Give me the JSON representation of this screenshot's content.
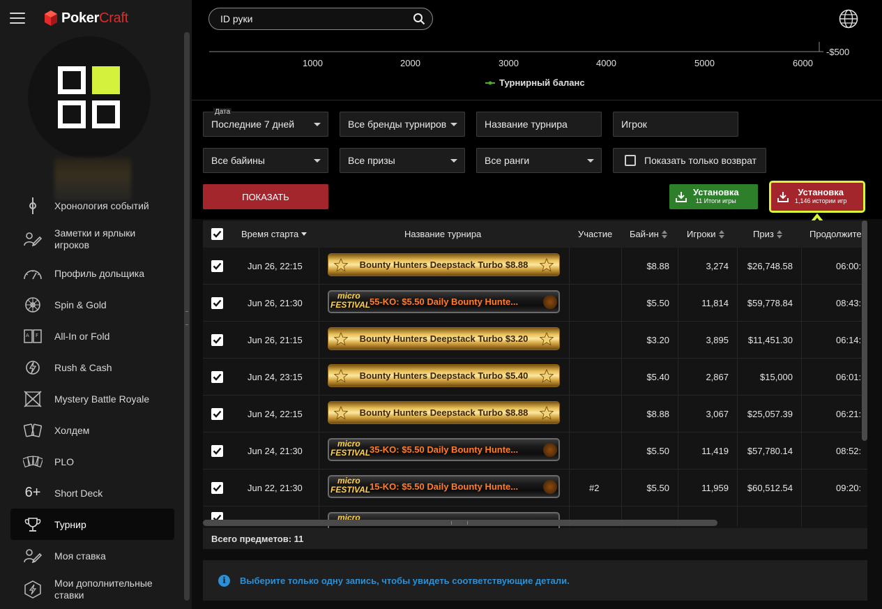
{
  "app": {
    "brand_word1": "Poker",
    "brand_word2": "Craft"
  },
  "search": {
    "placeholder": "ID руки"
  },
  "chart": {
    "x_ticks": [
      "1000",
      "2000",
      "3000",
      "4000",
      "5000",
      "6000"
    ],
    "y_tick": "-$500",
    "legend": "Турнирный баланс",
    "colors": {
      "series": "#4caf2a"
    }
  },
  "sidebar": {
    "items": [
      {
        "label": "Хронология событий",
        "icon": "timeline-icon"
      },
      {
        "label": "Заметки и ярлыки игроков",
        "icon": "notes-icon"
      },
      {
        "label": "Профиль дольщика",
        "icon": "gauge-icon"
      },
      {
        "label": "Spin & Gold",
        "icon": "wheel-icon"
      },
      {
        "label": "All-In or Fold",
        "icon": "cards-icon"
      },
      {
        "label": "Rush & Cash",
        "icon": "rush-icon"
      },
      {
        "label": "Mystery Battle Royale",
        "icon": "crossed-swords-icon"
      },
      {
        "label": "Холдем",
        "icon": "holdem-cards-icon"
      },
      {
        "label": "PLO",
        "icon": "plo-cards-icon"
      },
      {
        "label": "Short Deck",
        "icon": "six-plus-icon",
        "glyph": "6+"
      },
      {
        "label": "Турнир",
        "icon": "trophy-icon",
        "active": true
      },
      {
        "label": "Моя ставка",
        "icon": "stake-icon"
      },
      {
        "label": "Мои дополнительные ставки",
        "icon": "extra-stake-icon"
      }
    ]
  },
  "filters": {
    "date_label": "Дата",
    "date_value": "Последние 7 дней",
    "brands": "Все бренды турниров",
    "tournament_name": "Название турнира",
    "player": "Игрок",
    "buyins": "Все байины",
    "prizes": "Все призы",
    "ranks": "Все ранги",
    "refund_only": "Показать только возврат",
    "show_button": "ПОКАЗАТЬ",
    "download_summary": {
      "title": "Установка",
      "sub": "11 Итоги игры"
    },
    "download_history": {
      "title": "Установка",
      "sub": "1,146 истории игр"
    }
  },
  "table": {
    "headers": {
      "start": "Время старта",
      "name": "Название турнира",
      "place": "Участие",
      "buyin": "Бай-ин",
      "players": "Игроки",
      "prize": "Приз",
      "duration": "Продолжите"
    },
    "rows": [
      {
        "start": "Jun 26, 22:15",
        "name": "Bounty Hunters Deepstack Turbo $8.88",
        "style": "gold",
        "place": "",
        "buyin": "$8.88",
        "players": "3,274",
        "prize": "$26,748.58",
        "duration": "06:00:"
      },
      {
        "start": "Jun 26, 21:30",
        "name": "55-KO: $5.50 Daily Bounty Hunte...",
        "style": "micro",
        "place": "",
        "buyin": "$5.50",
        "players": "11,814",
        "prize": "$59,778.84",
        "duration": "08:43:"
      },
      {
        "start": "Jun 26, 21:15",
        "name": "Bounty Hunters Deepstack Turbo $3.20",
        "style": "gold",
        "place": "",
        "buyin": "$3.20",
        "players": "3,895",
        "prize": "$11,451.30",
        "duration": "06:14:"
      },
      {
        "start": "Jun 24, 23:15",
        "name": "Bounty Hunters Deepstack Turbo $5.40",
        "style": "gold",
        "place": "",
        "buyin": "$5.40",
        "players": "2,867",
        "prize": "$15,000",
        "duration": "06:01:"
      },
      {
        "start": "Jun 24, 22:15",
        "name": "Bounty Hunters Deepstack Turbo $8.88",
        "style": "gold",
        "place": "",
        "buyin": "$8.88",
        "players": "3,067",
        "prize": "$25,057.39",
        "duration": "06:21:"
      },
      {
        "start": "Jun 24, 21:30",
        "name": "35-KO: $5.50 Daily Bounty Hunte...",
        "style": "micro",
        "place": "",
        "buyin": "$5.50",
        "players": "11,419",
        "prize": "$57,780.14",
        "duration": "08:52:"
      },
      {
        "start": "Jun 22, 21:30",
        "name": "15-KO: $5.50 Daily Bounty Hunte...",
        "style": "micro",
        "place": "#2",
        "buyin": "$5.50",
        "players": "11,959",
        "prize": "$60,512.54",
        "duration": "09:20:"
      }
    ],
    "micro_logo_1": "micro",
    "micro_logo_2": "FESTIVAL"
  },
  "footer": {
    "total": "Всего предметов: 11",
    "info": "Выберите только одну запись, чтобы увидеть соответствующие детали."
  }
}
